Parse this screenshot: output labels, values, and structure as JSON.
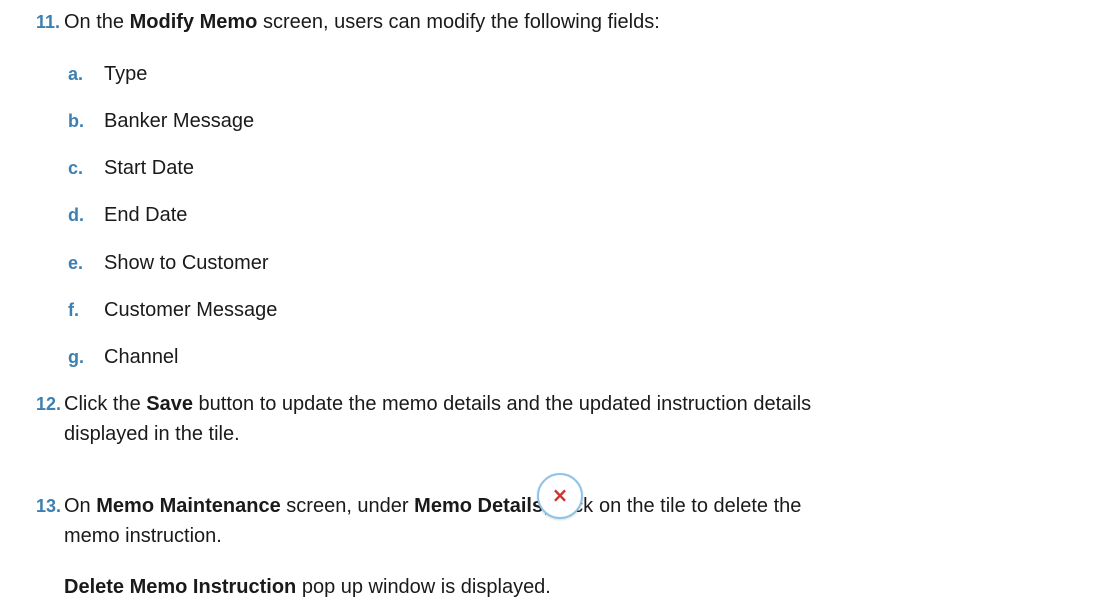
{
  "steps": [
    {
      "number": "11.",
      "pre": "On the ",
      "bold1": "Modify Memo",
      "post": " screen, users can modify the following fields:",
      "items": [
        {
          "letter": "a.",
          "label": "Type"
        },
        {
          "letter": "b.",
          "label": "Banker Message"
        },
        {
          "letter": "c.",
          "label": "Start Date"
        },
        {
          "letter": "d.",
          "label": "End Date"
        },
        {
          "letter": "e.",
          "label": "Show to Customer"
        },
        {
          "letter": "f.",
          "label": "Customer Message"
        },
        {
          "letter": "g.",
          "label": "Channel"
        }
      ]
    },
    {
      "number": "12.",
      "pre": "Click the ",
      "bold1": "Save",
      "post": " button to update the memo details and the updated instruction details",
      "line2": "displayed in the tile."
    },
    {
      "number": "13.",
      "pre": "On ",
      "bold1": "Memo Maintenance",
      "mid": " screen, under ",
      "bold2": "Memo Details",
      "mid2": ", click ",
      "post": " on the tile to delete the",
      "line2": "memo instruction.",
      "icon": "close-x-icon",
      "note_bold": "Delete Memo Instruction",
      "note_rest": " pop up window is displayed."
    }
  ]
}
